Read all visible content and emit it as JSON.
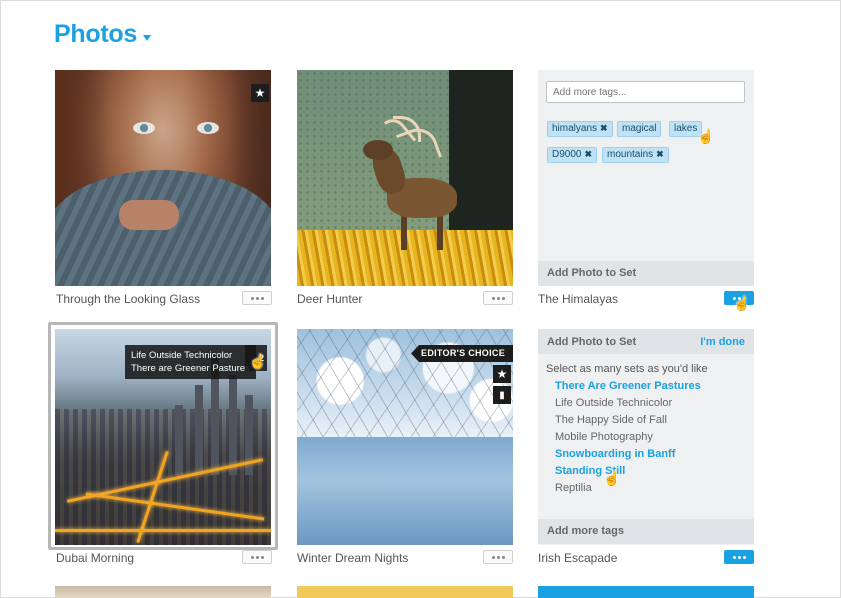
{
  "header": {
    "title": "Photos"
  },
  "photos": [
    {
      "caption": "Through the Looking Glass",
      "starred": true
    },
    {
      "caption": "Deer Hunter"
    },
    {
      "caption": "The Himalayas"
    },
    {
      "caption": "Dubai Morning",
      "selected": true,
      "sets_count": "2"
    },
    {
      "caption": "Winter Dream Nights",
      "badge": "EDITOR'S CHOICE"
    },
    {
      "caption": "Irish Escapade"
    }
  ],
  "tags_panel": {
    "placeholder": "Add more tags...",
    "tags": [
      "himalyans",
      "magical",
      "lakes",
      "D9000",
      "mountains"
    ],
    "footer": "Add Photo to Set"
  },
  "sets_panel": {
    "title": "Add Photo to Set",
    "done": "I'm done",
    "prompt": "Select as many sets as you'd like",
    "sets": [
      {
        "name": "There Are Greener Pastures",
        "selected": true
      },
      {
        "name": "Life Outside Technicolor",
        "selected": false
      },
      {
        "name": "The Happy Side of Fall",
        "selected": false
      },
      {
        "name": "Mobile Photography",
        "selected": false
      },
      {
        "name": "Snowboarding in Banff",
        "selected": true
      },
      {
        "name": "Standing Still",
        "selected": true
      },
      {
        "name": "Reptilia",
        "selected": false
      }
    ],
    "footer": "Add more tags"
  },
  "dubai_popover": {
    "sets": [
      "Life Outside Technicolor",
      "There are Greener Pastures"
    ]
  },
  "colors": {
    "accent": "#1aa1e1",
    "tag_bg": "#bfe3f5",
    "panel_bg": "#eef0f2"
  },
  "icons": [
    "star-icon",
    "stack-icon",
    "more-icon",
    "close-icon",
    "hand-cursor-icon",
    "caret-down-icon"
  ]
}
